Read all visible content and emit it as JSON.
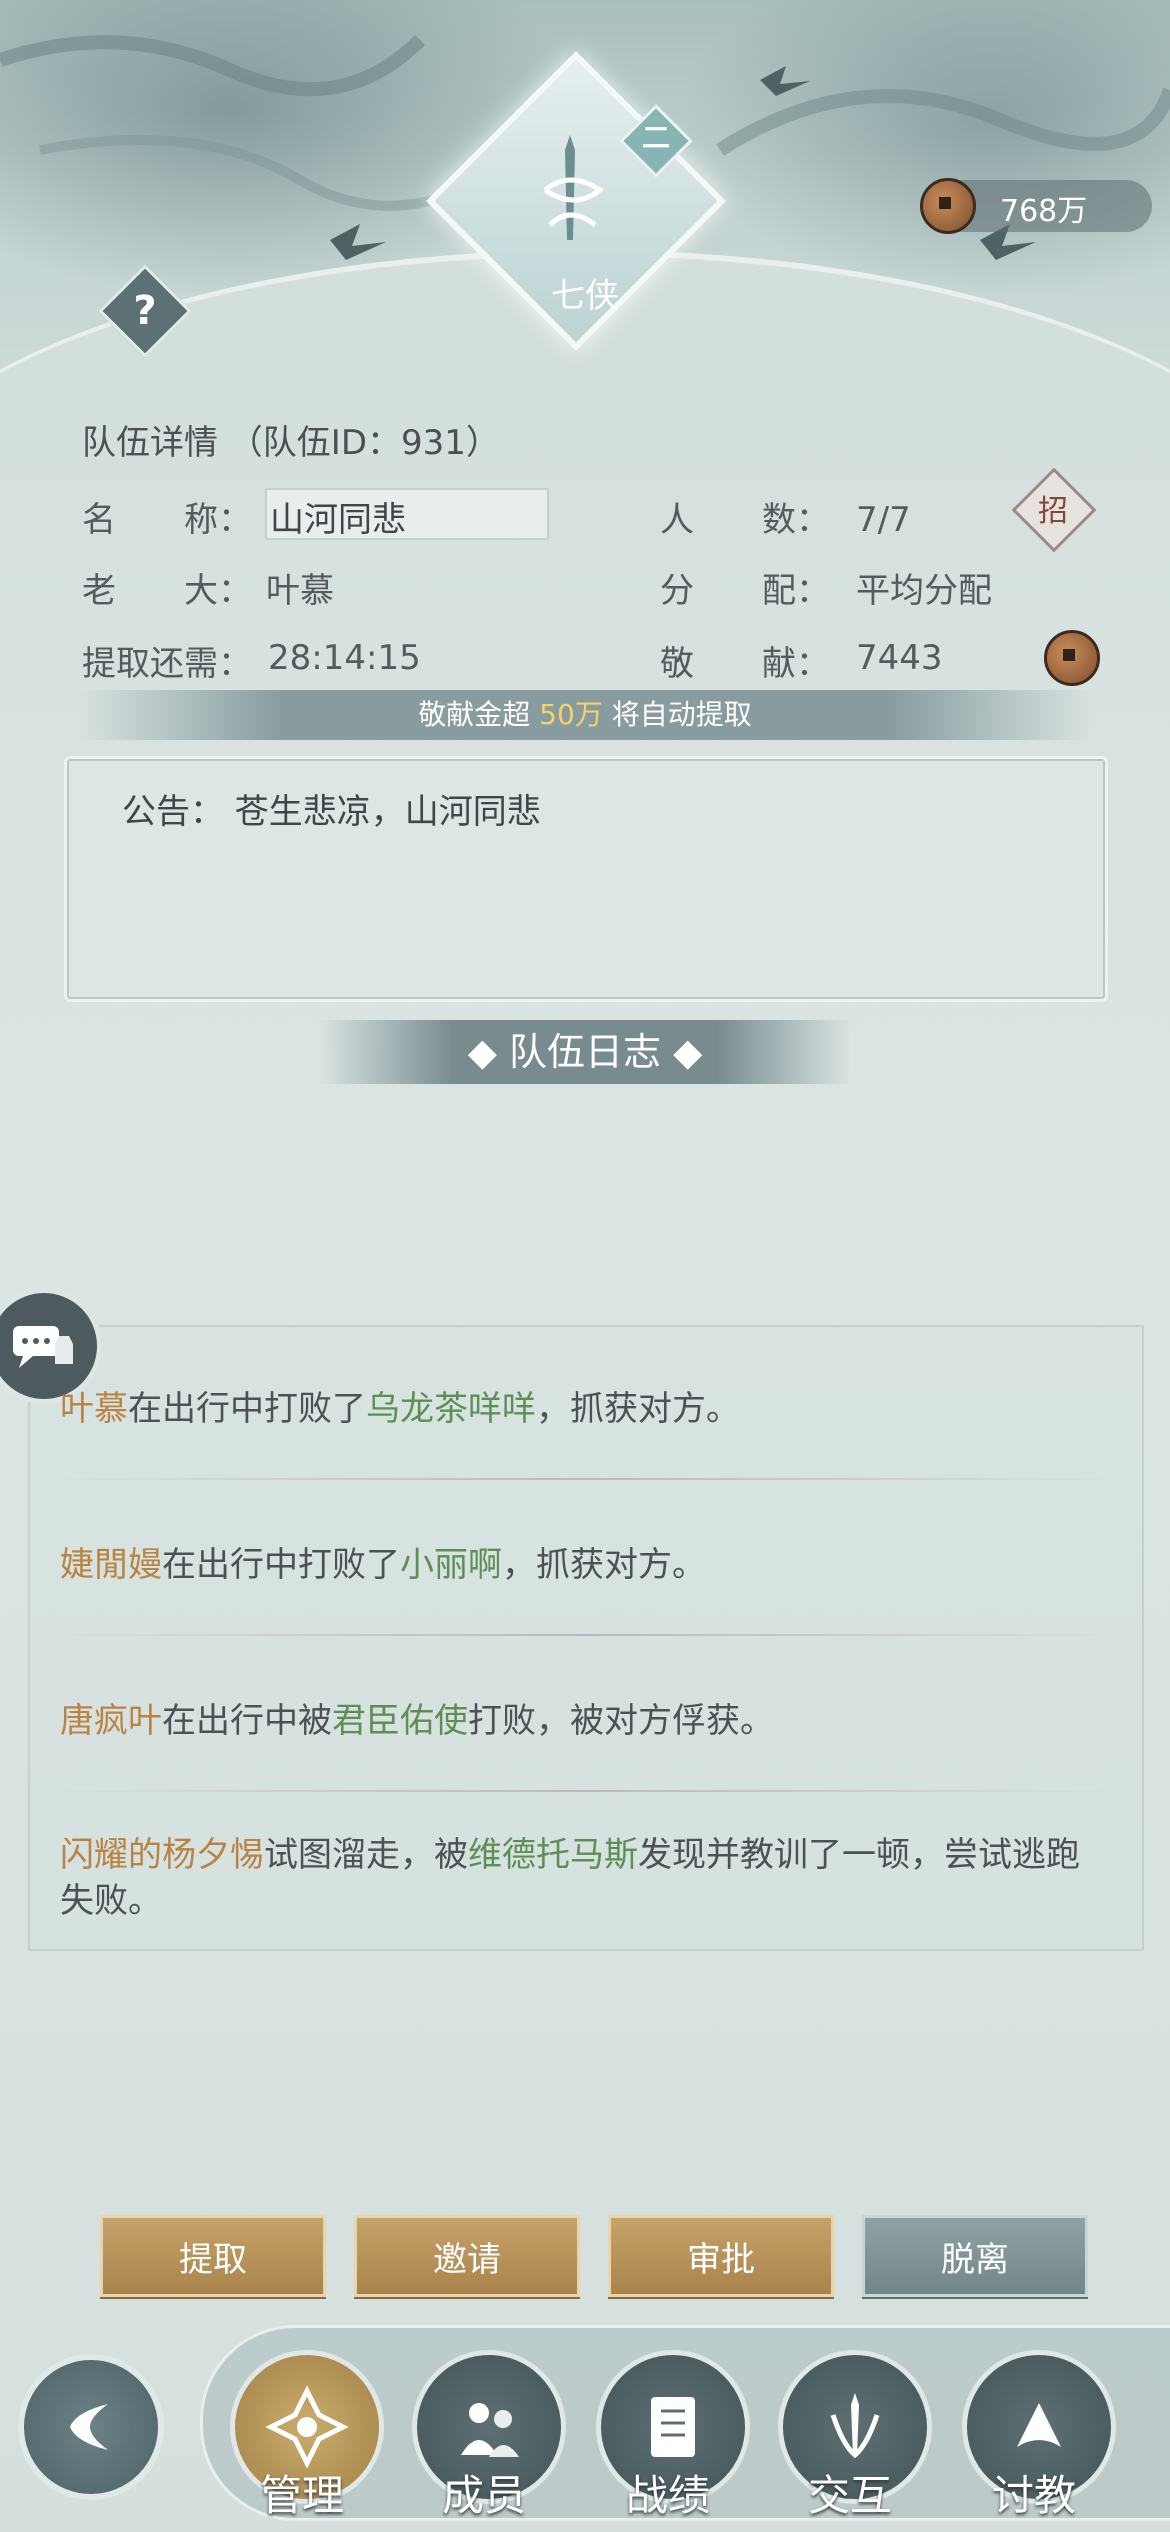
{
  "header": {
    "emblem_rank": "二",
    "emblem_text": "七侠",
    "coins": "768万"
  },
  "team": {
    "title": "队伍详情 （队伍ID：931）",
    "name_label": "名　　称：",
    "name_value": "山河同悲",
    "members_label": "人　　数：",
    "members_value": "7/7",
    "leader_label": "老　　大：",
    "leader_value": "叶慕",
    "distribution_label": "分　　配：",
    "distribution_value": "平均分配",
    "withdraw_label": "提取还需：",
    "withdraw_value": "28:14:15",
    "contribution_label": "敬　　献：",
    "contribution_value": "7443",
    "recruit_label": "招"
  },
  "auto_withdraw": {
    "prefix": "敬献金超 ",
    "amount": "50万",
    "suffix": " 将自动提取"
  },
  "notice": {
    "text": "公告：  苍生悲凉，山河同悲"
  },
  "log": {
    "title": "◆ 队伍日志 ◆",
    "entries": [
      {
        "actor": "叶慕",
        "mid": "在出行中打败了",
        "target": "乌龙茶咩咩",
        "end": "，抓获对方。"
      },
      {
        "actor": "婕閒嫚",
        "mid": "在出行中打败了",
        "target": "小丽啊",
        "end": "，抓获对方。"
      },
      {
        "actor": "唐疯叶",
        "mid": "在出行中被",
        "target": "君臣佑使",
        "end": "打败，被对方俘获。"
      },
      {
        "actor": "闪耀的杨夕惕",
        "mid": "试图溜走，被",
        "target": "维德托马斯",
        "end": "发现并教训了一顿，尝试逃跑失败。"
      }
    ]
  },
  "buttons": {
    "withdraw": "提取",
    "invite": "邀请",
    "approve": "审批",
    "leave": "脱离"
  },
  "nav": {
    "manage": "管理",
    "members": "成员",
    "records": "战绩",
    "interact": "交互",
    "discuss": "讨教"
  },
  "colors": {
    "accent_gold": "#b98443",
    "highlight_green": "#5d8f55",
    "auto_amount": "#f3d36b"
  }
}
